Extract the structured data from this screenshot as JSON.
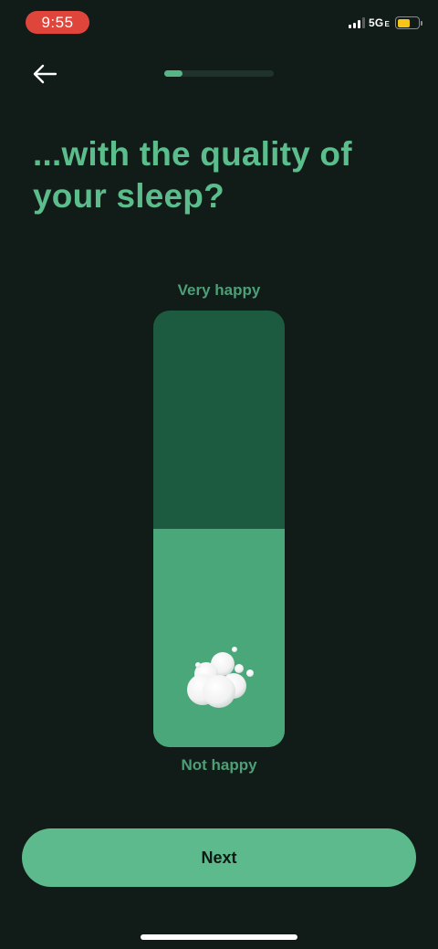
{
  "status_bar": {
    "time": "9:55",
    "network": "5G",
    "network_suffix": "E",
    "battery_level": 0.6,
    "colors": {
      "time_pill": "#e0453c",
      "battery": "#f5c518"
    }
  },
  "header": {
    "back_icon": "arrow-left-icon",
    "progress": 0.17
  },
  "question": {
    "title": "...with the quality of your sleep?"
  },
  "slider": {
    "top_label": "Very happy",
    "bottom_label": "Not happy",
    "value": 0.5,
    "handle_icon": "cloud-icon",
    "colors": {
      "track": "#1c5b3f",
      "fill": "#4aa77a",
      "label": "#4e9e78"
    }
  },
  "actions": {
    "next_label": "Next"
  },
  "theme": {
    "background": "#111b18",
    "accent": "#5dba8c",
    "title_color": "#5cbd8c"
  }
}
